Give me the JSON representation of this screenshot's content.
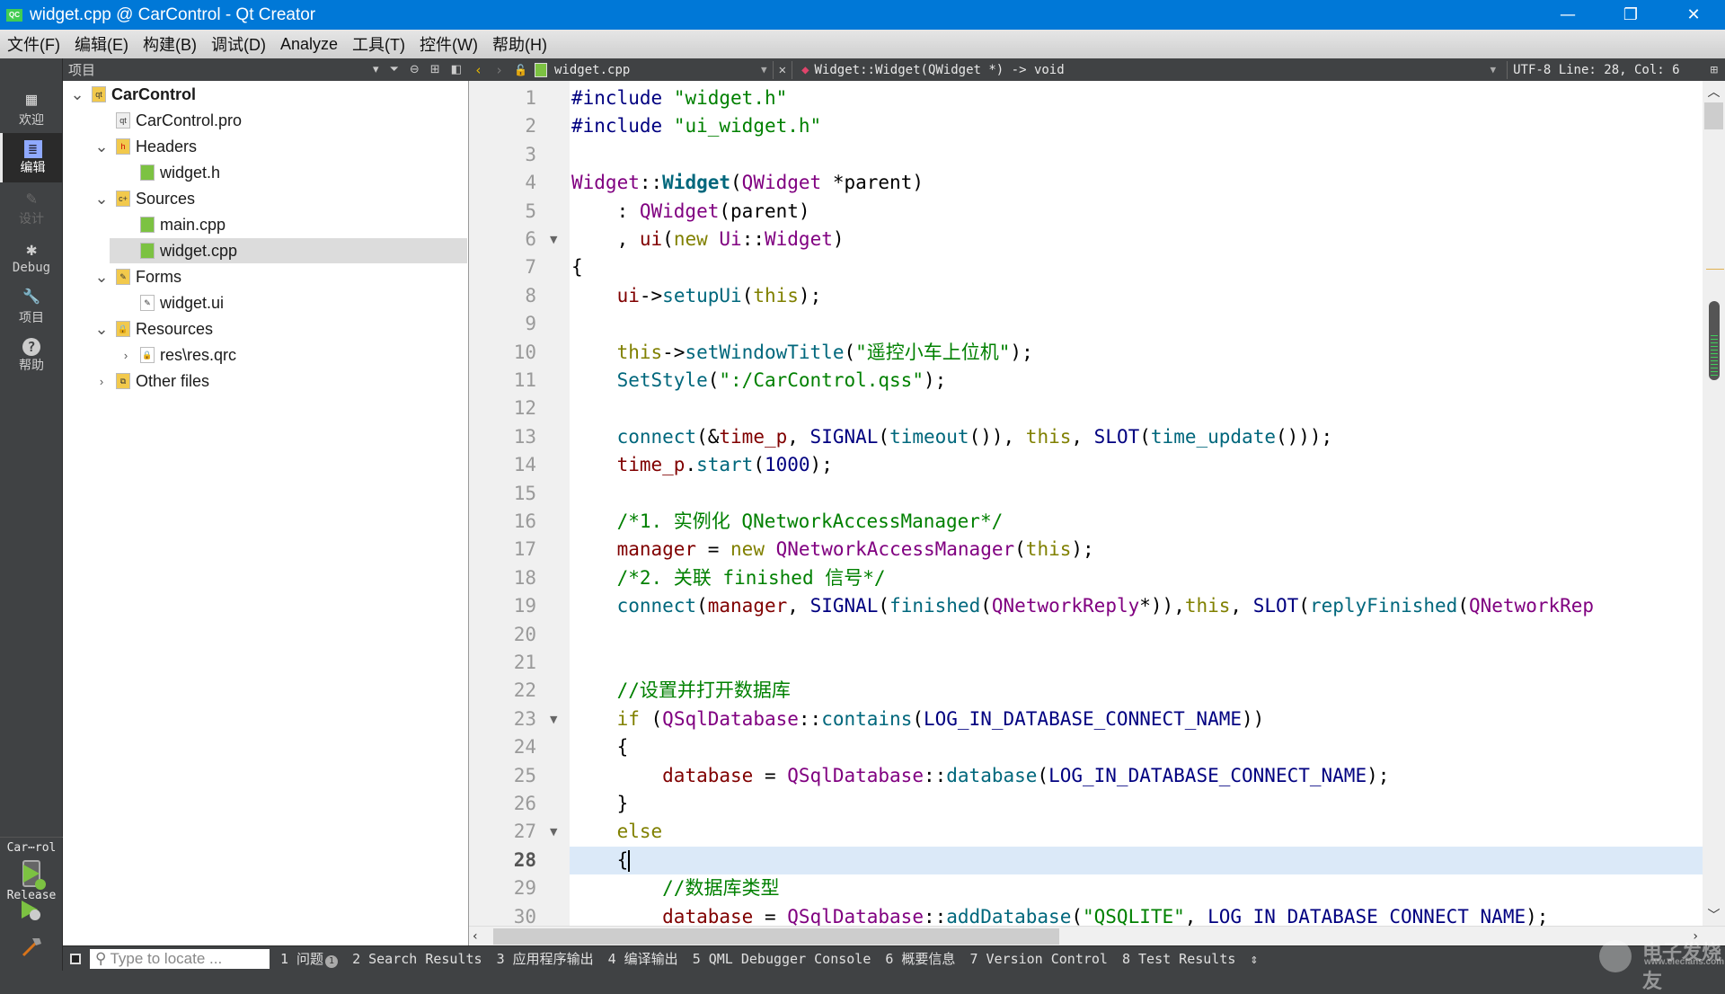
{
  "window": {
    "title": "widget.cpp @ CarControl - Qt Creator",
    "app_icon": "QC",
    "controls": {
      "minimize": "—",
      "maximize": "❐",
      "close": "✕"
    }
  },
  "menu": [
    "文件(F)",
    "编辑(E)",
    "构建(B)",
    "调试(D)",
    "Analyze",
    "工具(T)",
    "控件(W)",
    "帮助(H)"
  ],
  "modes": [
    {
      "label": "欢迎",
      "icon": "grid-icon",
      "glyph": "▦",
      "state": "normal"
    },
    {
      "label": "编辑",
      "icon": "edit-doc-icon",
      "glyph": "≣",
      "state": "active"
    },
    {
      "label": "设计",
      "icon": "pencil-icon",
      "glyph": "✎",
      "state": "disabled"
    },
    {
      "label": "Debug",
      "icon": "bug-icon",
      "glyph": "✱",
      "state": "normal"
    },
    {
      "label": "项目",
      "icon": "wrench-icon",
      "glyph": "🔧",
      "state": "normal"
    },
    {
      "label": "帮助",
      "icon": "help-icon",
      "glyph": "?",
      "state": "normal"
    }
  ],
  "kit": {
    "project": "Car⋯rol",
    "config": "Release"
  },
  "project_panel": {
    "title": "项目",
    "tree": [
      {
        "label": "CarControl",
        "level": 0,
        "expander": "open",
        "icon": "qt-project-folder-icon",
        "bold": true
      },
      {
        "label": "CarControl.pro",
        "level": 1,
        "expander": "none",
        "icon": "pro-file-icon"
      },
      {
        "label": "Headers",
        "level": 1,
        "expander": "open",
        "icon": "headers-folder-icon"
      },
      {
        "label": "widget.h",
        "level": 2,
        "expander": "none",
        "icon": "source-file-icon"
      },
      {
        "label": "Sources",
        "level": 1,
        "expander": "open",
        "icon": "sources-folder-icon"
      },
      {
        "label": "main.cpp",
        "level": 2,
        "expander": "none",
        "icon": "source-file-icon"
      },
      {
        "label": "widget.cpp",
        "level": 2,
        "expander": "none",
        "icon": "source-file-icon",
        "selected": true
      },
      {
        "label": "Forms",
        "level": 1,
        "expander": "open",
        "icon": "forms-folder-icon"
      },
      {
        "label": "widget.ui",
        "level": 2,
        "expander": "none",
        "icon": "ui-file-icon"
      },
      {
        "label": "Resources",
        "level": 1,
        "expander": "open",
        "icon": "resources-folder-icon"
      },
      {
        "label": "res\\res.qrc",
        "level": 2,
        "expander": "closed",
        "icon": "qrc-file-icon"
      },
      {
        "label": "Other files",
        "level": 1,
        "expander": "closed",
        "icon": "other-files-folder-icon"
      }
    ]
  },
  "editor": {
    "file": "widget.cpp",
    "symbol": "Widget::Widget(QWidget *) -> void",
    "status": "UTF-8 Line: 28, Col: 6",
    "current_line": 28,
    "lines": [
      {
        "n": 1,
        "fold": false,
        "html": "<span class=\"pp\">#include</span> <span class=\"str\">\"widget.h\"</span>"
      },
      {
        "n": 2,
        "fold": false,
        "html": "<span class=\"pp\">#include</span> <span class=\"str\">\"ui_widget.h\"</span>"
      },
      {
        "n": 3,
        "fold": false,
        "html": ""
      },
      {
        "n": 4,
        "fold": false,
        "html": "<span class=\"cls\">Widget</span>::<span class=\"fn bold\">Widget</span>(<span class=\"cls\">QWidget</span> *parent)"
      },
      {
        "n": 5,
        "fold": false,
        "html": "    : <span class=\"cls\">QWidget</span>(parent)"
      },
      {
        "n": 6,
        "fold": true,
        "html": "    , <span class=\"mem\">ui</span>(<span class=\"kw\">new</span> <span class=\"cls\">Ui</span>::<span class=\"cls\">Widget</span>)"
      },
      {
        "n": 7,
        "fold": false,
        "html": "{"
      },
      {
        "n": 8,
        "fold": false,
        "html": "    <span class=\"mem\">ui</span>-&gt;<span class=\"fn\">setupUi</span>(<span class=\"kw\">this</span>);"
      },
      {
        "n": 9,
        "fold": false,
        "html": ""
      },
      {
        "n": 10,
        "fold": false,
        "html": "    <span class=\"kw\">this</span>-&gt;<span class=\"fn\">setWindowTitle</span>(<span class=\"str\">\"遥控小车上位机\"</span>);"
      },
      {
        "n": 11,
        "fold": false,
        "html": "    <span class=\"fn\">SetStyle</span>(<span class=\"str\">\":/CarControl.qss\"</span>);"
      },
      {
        "n": 12,
        "fold": false,
        "html": ""
      },
      {
        "n": 13,
        "fold": false,
        "html": "    <span class=\"fn\">connect</span>(&amp;<span class=\"mem\">time_p</span>, <span class=\"mac\">SIGNAL</span>(<span class=\"fn\">timeout</span>()), <span class=\"kw\">this</span>, <span class=\"mac\">SLOT</span>(<span class=\"fn\">time_update</span>()));"
      },
      {
        "n": 14,
        "fold": false,
        "html": "    <span class=\"mem\">time_p</span>.<span class=\"fn\">start</span>(<span class=\"num\">1000</span>);"
      },
      {
        "n": 15,
        "fold": false,
        "html": ""
      },
      {
        "n": 16,
        "fold": false,
        "html": "    <span class=\"cm\">/*1. 实例化 QNetworkAccessManager*/</span>"
      },
      {
        "n": 17,
        "fold": false,
        "html": "    <span class=\"mem\">manager</span> = <span class=\"kw\">new</span> <span class=\"cls\">QNetworkAccessManager</span>(<span class=\"kw\">this</span>);"
      },
      {
        "n": 18,
        "fold": false,
        "html": "    <span class=\"cm\">/*2. 关联 finished 信号*/</span>"
      },
      {
        "n": 19,
        "fold": false,
        "html": "    <span class=\"fn\">connect</span>(<span class=\"mem\">manager</span>, <span class=\"mac\">SIGNAL</span>(<span class=\"fn\">finished</span>(<span class=\"cls\">QNetworkReply</span>*)),<span class=\"kw\">this</span>, <span class=\"mac\">SLOT</span>(<span class=\"fn\">replyFinished</span>(<span class=\"cls\">QNetworkRep</span>"
      },
      {
        "n": 20,
        "fold": false,
        "html": ""
      },
      {
        "n": 21,
        "fold": false,
        "html": ""
      },
      {
        "n": 22,
        "fold": false,
        "html": "    <span class=\"cm\">//设置并打开数据库</span>"
      },
      {
        "n": 23,
        "fold": true,
        "html": "    <span class=\"kw\">if</span> (<span class=\"cls\">QSqlDatabase</span>::<span class=\"fn\">contains</span>(<span class=\"mac\">LOG_IN_DATABASE_CONNECT_NAME</span>))"
      },
      {
        "n": 24,
        "fold": false,
        "html": "    {"
      },
      {
        "n": 25,
        "fold": false,
        "html": "        <span class=\"mem\">database</span> = <span class=\"cls\">QSqlDatabase</span>::<span class=\"fn\">database</span>(<span class=\"mac\">LOG_IN_DATABASE_CONNECT_NAME</span>);"
      },
      {
        "n": 26,
        "fold": false,
        "html": "    }"
      },
      {
        "n": 27,
        "fold": true,
        "html": "    <span class=\"kw\">else</span>"
      },
      {
        "n": 28,
        "fold": false,
        "html": "    {<span class=\"caret\"></span>"
      },
      {
        "n": 29,
        "fold": false,
        "html": "        <span class=\"cm\">//数据库类型</span>"
      },
      {
        "n": 30,
        "fold": false,
        "html": "        <span class=\"mem\">database</span> = <span class=\"cls\">QSqlDatabase</span>::<span class=\"fn\">addDatabase</span>(<span class=\"str\">\"QSQLITE\"</span>, <span class=\"mac\">LOG_IN_DATABASE_CONNECT_NAME</span>);"
      }
    ]
  },
  "output_bar": {
    "locator_placeholder": "Type to locate ...",
    "tabs": [
      {
        "label": "1 问题",
        "badge": "1"
      },
      {
        "label": "2 Search Results"
      },
      {
        "label": "3 应用程序输出"
      },
      {
        "label": "4 编译输出"
      },
      {
        "label": "5 QML Debugger Console"
      },
      {
        "label": "6 概要信息"
      },
      {
        "label": "7 Version Control"
      },
      {
        "label": "8 Test Results"
      }
    ]
  },
  "watermark": {
    "text": "电子发烧友",
    "url_text": "www.elecfans.com"
  }
}
